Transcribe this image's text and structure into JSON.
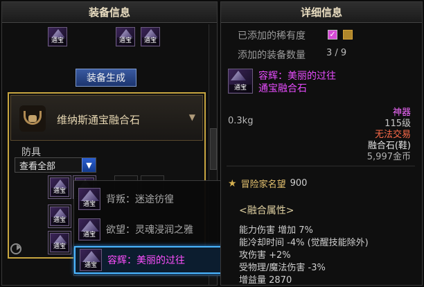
{
  "left_panel": {
    "title": "装备信息",
    "top_icons": [
      {
        "tag": "通宝",
        "name": "item-icon-1"
      },
      {
        "tag": "通宝",
        "name": "item-icon-2"
      },
      {
        "tag": "通宝",
        "name": "item-icon-3"
      }
    ],
    "generate_button": "装备生成",
    "stone": {
      "name": "维纳斯通宝融合石"
    },
    "category": "防具",
    "dropdown_value": "查看全部",
    "slots": [
      {
        "tag": "通宝"
      },
      {
        "tag": "通宝"
      },
      {
        "tag": "通宝"
      },
      {
        "tag": "通宝"
      }
    ]
  },
  "popup": {
    "items": [
      {
        "label": "背叛：迷途彷徨",
        "tag": "通宝",
        "selected": false
      },
      {
        "label": "欲望：灵魂浸润之雅",
        "tag": "通宝",
        "selected": false
      },
      {
        "label": "容辉：美丽的过往",
        "tag": "通宝",
        "selected": true
      }
    ]
  },
  "right_panel": {
    "title": "详细信息",
    "added_rarity_label": "已添加的稀有度",
    "added_count_label": "添加的装备数量",
    "added_count_value": "3 / 9",
    "item_name": "容辉：美丽的过往",
    "item_subtitle": "通宝融合石",
    "weight": "0.3kg",
    "rarity": "神器",
    "level": "115级",
    "trade": "无法交易",
    "type": "融合石(鞋)",
    "price": "5,997金币",
    "fame_label": "冒险家名望",
    "fame_value": "900",
    "attr_title": "<融合属性>",
    "attributes": [
      "能力伤害 增加 7%",
      "能冷却时间 -4% (觉醒技能除外)",
      "攻伤害 +2%",
      "受物理/魔法伤害 -3%",
      "增益量 2870"
    ]
  },
  "colors": {
    "accent_gold": "#c8a640",
    "selected_border": "#4ab6ff",
    "epic_pink": "#e84dff"
  }
}
